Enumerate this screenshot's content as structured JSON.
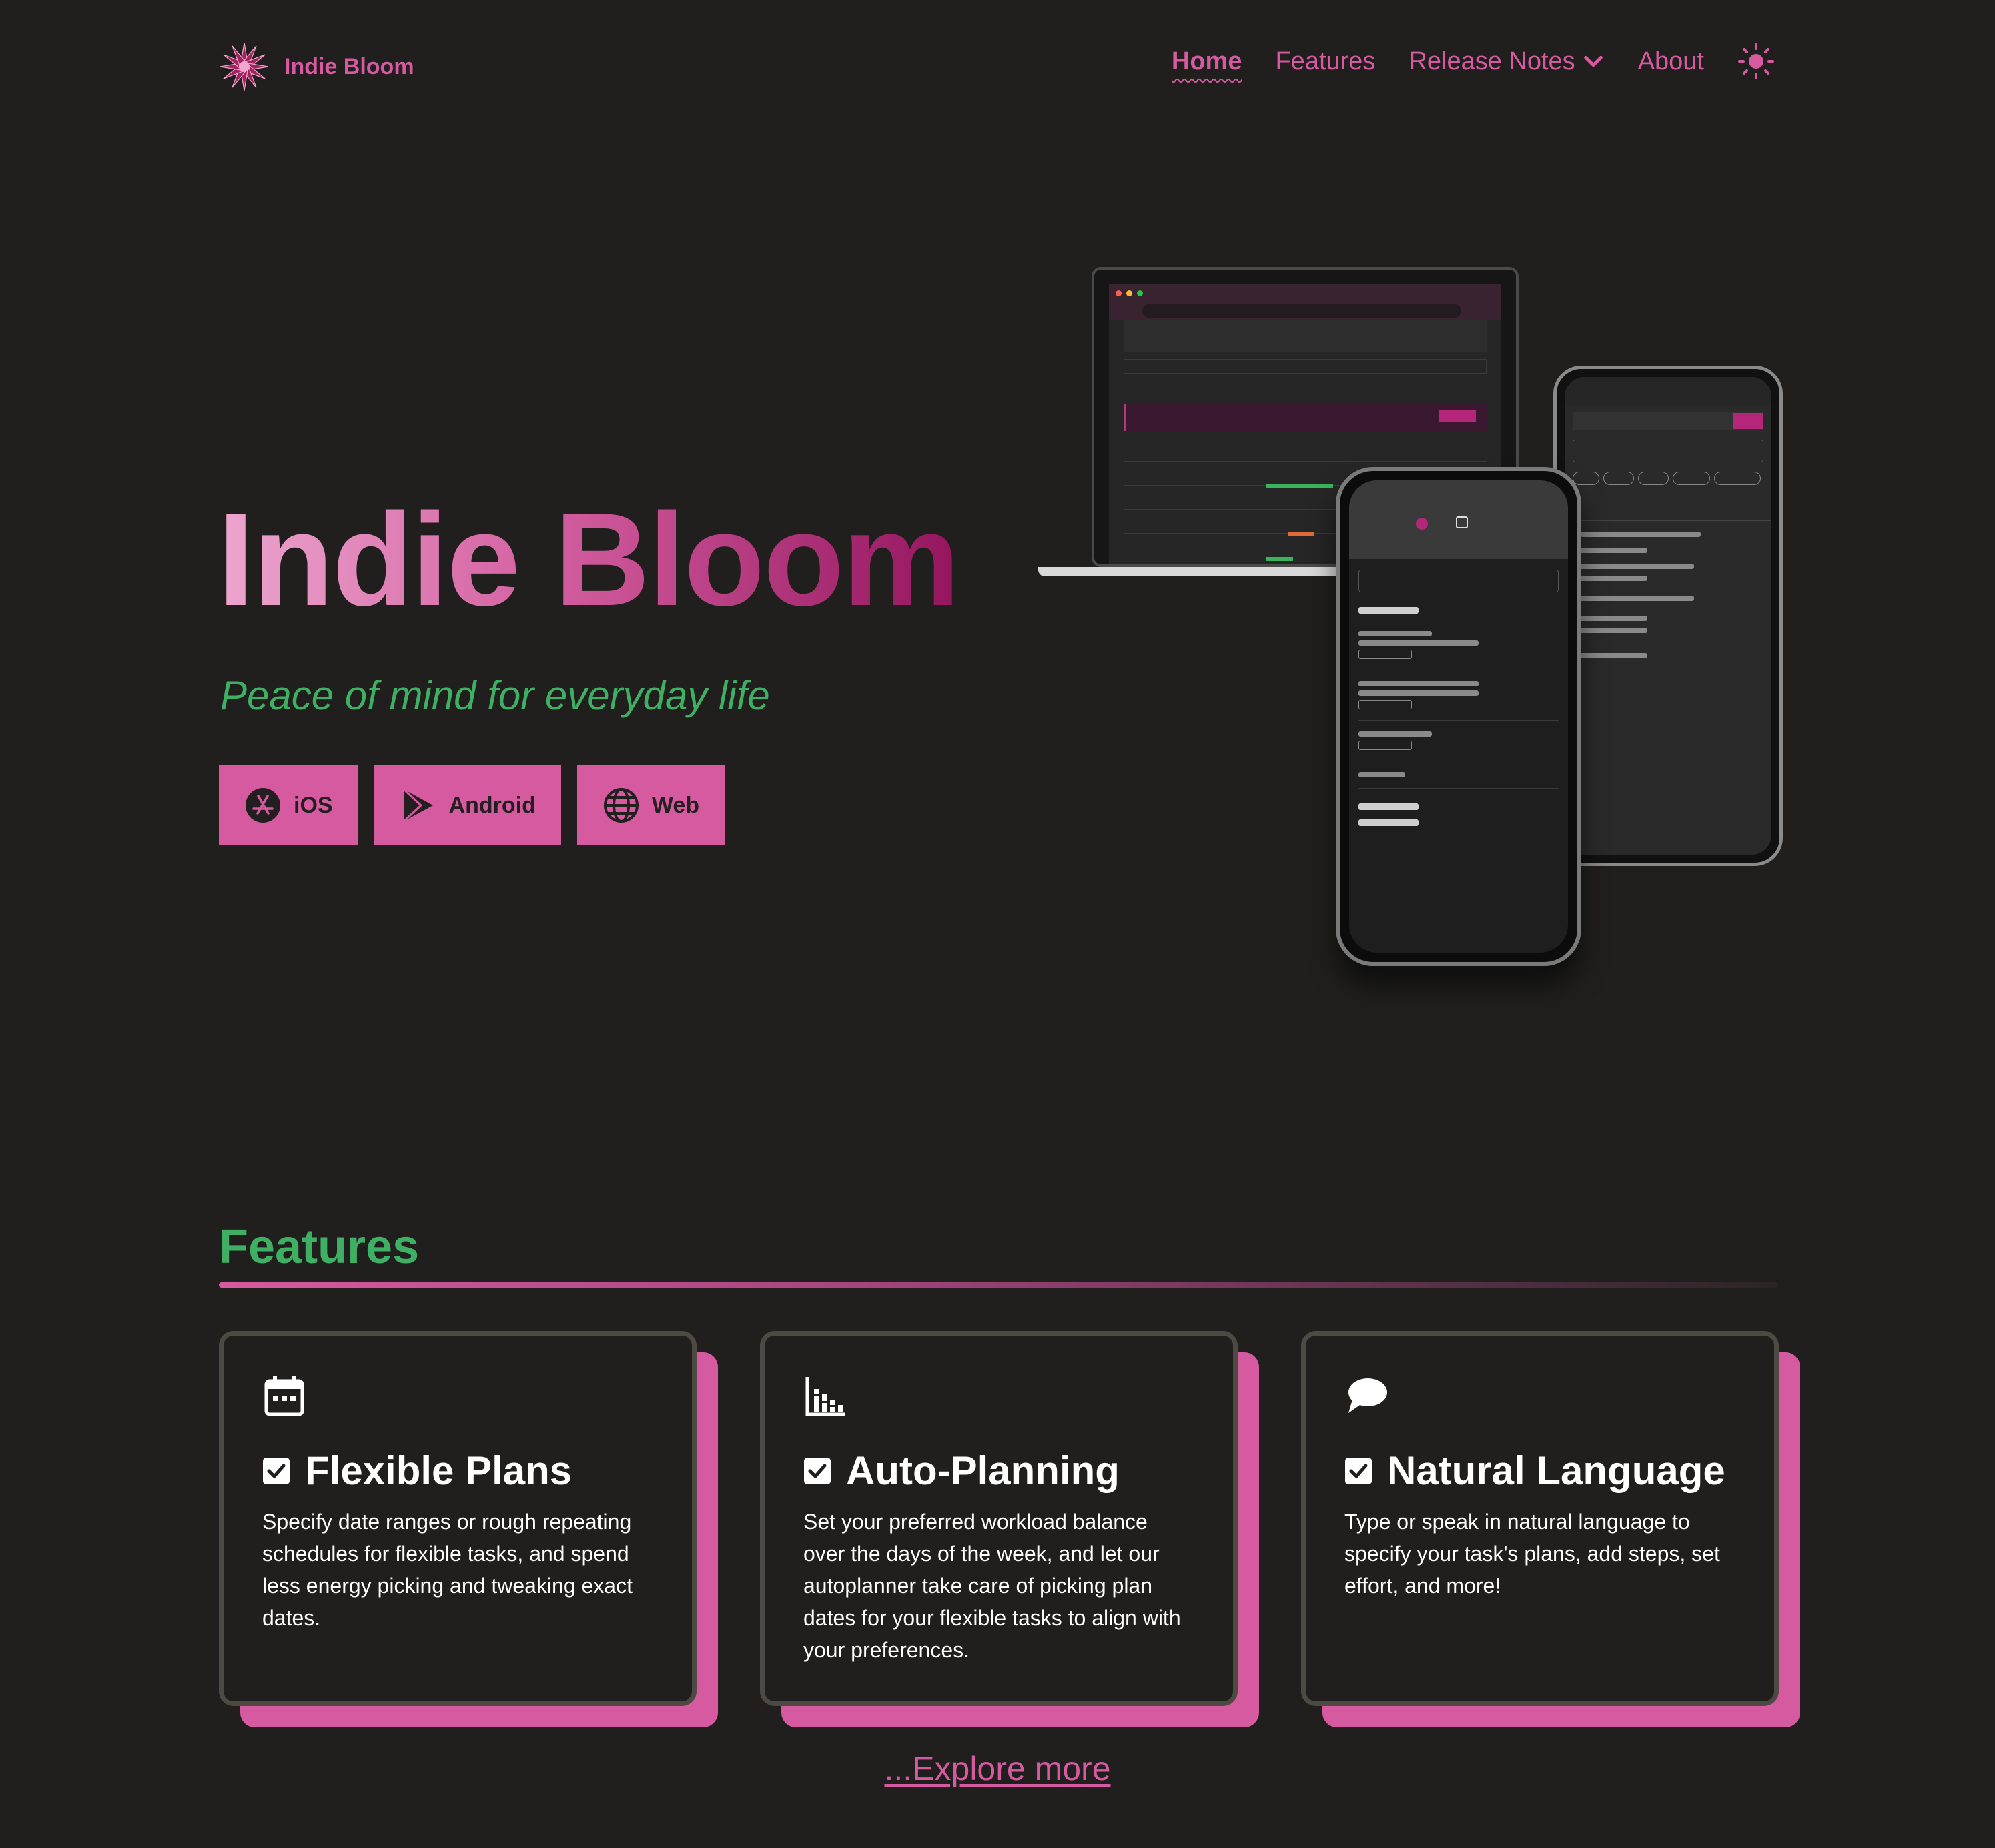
{
  "nav": {
    "brand": "Indie Bloom",
    "links": {
      "home": "Home",
      "features": "Features",
      "release_notes": "Release Notes",
      "about": "About"
    },
    "icons": {
      "logo": "flower-logo-icon",
      "dropdown": "chevron-down-icon",
      "theme": "sun-icon"
    }
  },
  "hero": {
    "title": "Indie Bloom",
    "subtitle": "Peace of mind for everyday life",
    "buttons": {
      "ios": "iOS",
      "android": "Android",
      "web": "Web"
    }
  },
  "features": {
    "title": "Features",
    "cards": [
      {
        "icon": "calendar-icon",
        "title": "Flexible Plans",
        "body": "Specify date ranges or rough repeating schedules for flexible tasks, and spend less energy picking and tweaking exact dates."
      },
      {
        "icon": "bar-chart-icon",
        "title": "Auto-Planning",
        "body": "Set your preferred workload balance over the days of the week, and let our autoplanner take care of picking plan dates for your flexible tasks to align with your preferences."
      },
      {
        "icon": "speech-bubble-icon",
        "title": "Natural Language",
        "body": "Type or speak in natural language to specify your task's plans, add steps, set effort, and more!"
      }
    ],
    "explore": "...Explore more"
  },
  "colors": {
    "background": "#201f1e",
    "accent_pink": "#d65aa0",
    "accent_green": "#3fb063",
    "card_border": "#4c4a43"
  }
}
